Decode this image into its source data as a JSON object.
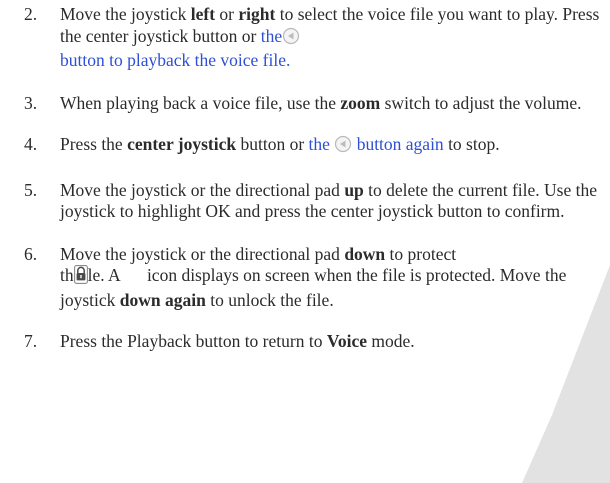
{
  "steps": [
    {
      "number": "2.",
      "t1": "Move the joystick ",
      "b1": "left",
      "t2": " or ",
      "b2": "right",
      "t3": " to select the voice file you want to play. Press the center joystick button or ",
      "blue1": "the",
      "blue2": " button to playback the voice file."
    },
    {
      "number": "3.",
      "t1": "When playing back a voice file, use the ",
      "b1": "zoom",
      "t2": " switch to adjust the volume."
    },
    {
      "number": "4.",
      "t1": "Press the ",
      "b1": "center joystick",
      "t2": " button or ",
      "blue1": "the",
      "blue2": " button again",
      "t3": " to stop."
    },
    {
      "number": "5.",
      "t1": "Move the joystick or the directional pad ",
      "b1": "up",
      "t2": " to delete the current file. Use the joystick to highlight OK and press the center joystick button to confirm."
    },
    {
      "number": "6.",
      "t1": "Move the joystick or the directional pad ",
      "b1": "down",
      "t2": " to protect",
      "t3": "th",
      "t4": "le. A",
      "t5": "icon displays on screen when the file is protected. Move the joystick ",
      "b2": "down again",
      "t6": " to unlock the file."
    },
    {
      "number": "7.",
      "t1": "Press the Playback button to return to ",
      "b1": "Voice",
      "t2": " mode."
    }
  ],
  "icons": {
    "playback": "playback-icon",
    "protect": "lock-icon"
  },
  "colors": {
    "text": "#2b2b2b",
    "link": "#2e4fd6",
    "corner": "#e3e3e3"
  }
}
